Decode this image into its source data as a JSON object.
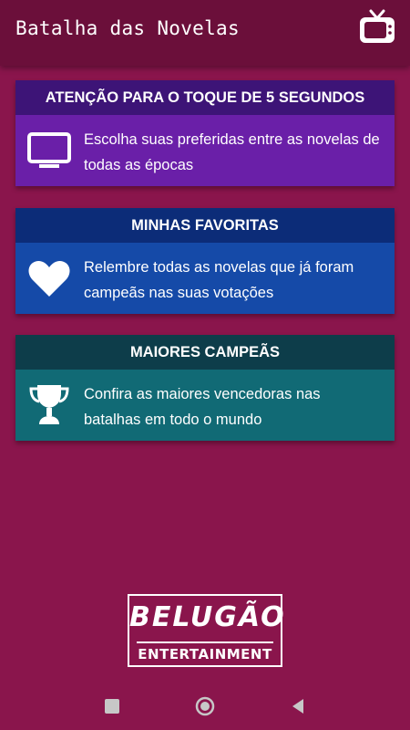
{
  "appbar": {
    "title": "Batalha das Novelas",
    "action_icon": "tv-icon"
  },
  "cards": [
    {
      "title": "ATENÇÃO PARA O TOQUE DE 5 SEGUNDOS",
      "text": "Escolha suas preferidas entre as novelas de todas as épocas",
      "icon": "monitor-icon",
      "header_color": "#3d1477",
      "body_color": "#6a1fa8"
    },
    {
      "title": "MINHAS FAVORITAS",
      "text": "Relembre todas as novelas que já foram campeãs nas suas votações",
      "icon": "heart-icon",
      "header_color": "#0c2c78",
      "body_color": "#154aa8"
    },
    {
      "title": "MAIORES CAMPEÃS",
      "text": "Confira as maiores vencedoras nas batalhas em todo o mundo",
      "icon": "trophy-icon",
      "header_color": "#0d3d4a",
      "body_color": "#116a75"
    }
  ],
  "logo": {
    "top": "BELUGÃO",
    "bottom": "ENTERTAINMENT"
  },
  "navbar": {
    "items": [
      "recents-icon",
      "home-icon",
      "back-icon"
    ]
  },
  "colors": {
    "background": "#8a154c",
    "appbar": "#6b0f3a"
  }
}
